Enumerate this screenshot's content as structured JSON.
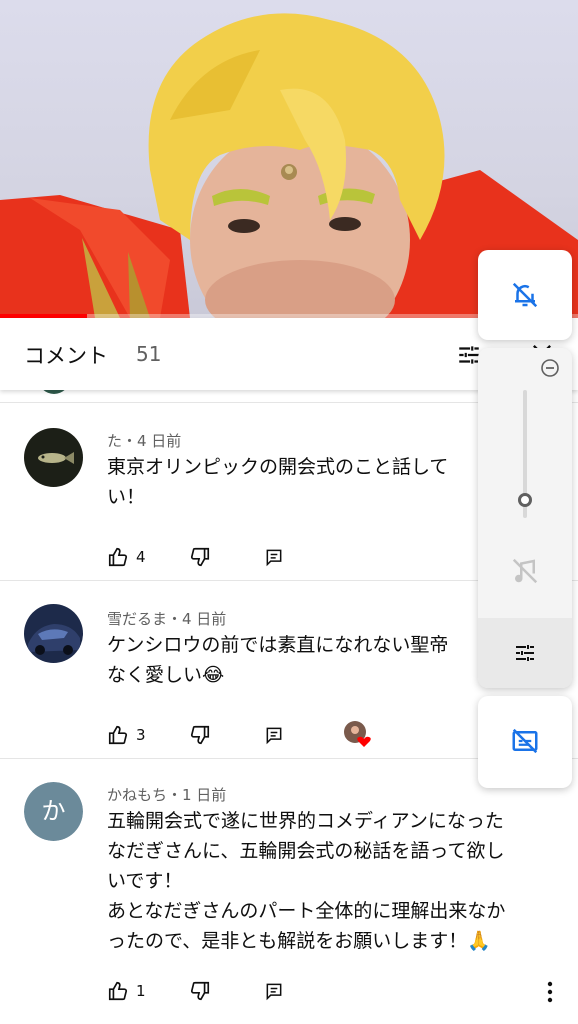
{
  "video": {
    "progress": 0.15
  },
  "comments_header": {
    "title": "コメント",
    "count": "51",
    "filter_icon": "tune-icon",
    "close_icon": "close-icon"
  },
  "comments": [
    {
      "author_time": "た・4 日前",
      "text": "東京オリンピックの開会式のこと話して\nい！",
      "likes": "4",
      "avatar": "fish-photo"
    },
    {
      "author_time": "雪だるま・4 日前",
      "text": "ケンシロウの前では素直になれない聖帝\nなく愛しい😂",
      "likes": "3",
      "avatar": "car-photo",
      "hearted_by_creator": true
    },
    {
      "author_time": "かねもち・1 日前",
      "avatar_letter": "か",
      "text": "五輪開会式で遂に世界的コメディアンになった\nなだぎさんに、五輪開会式の秘話を語って欲し\nいです！\nあとなだぎさんのパート全体的に理解出来なか\nったので、是非とも解説をお願いします！🙏",
      "likes": "1"
    }
  ],
  "side_panel": {
    "icons": [
      "notifications-off-icon",
      "zoom-out-icon",
      "vibration-off-icon",
      "tune-icon",
      "captions-off-icon"
    ],
    "slider_value": 0.1,
    "accent": "#1a73e8"
  },
  "colors": {
    "accent": "#1a73e8",
    "progress": "#ff0000",
    "secondary_text": "#606060"
  }
}
